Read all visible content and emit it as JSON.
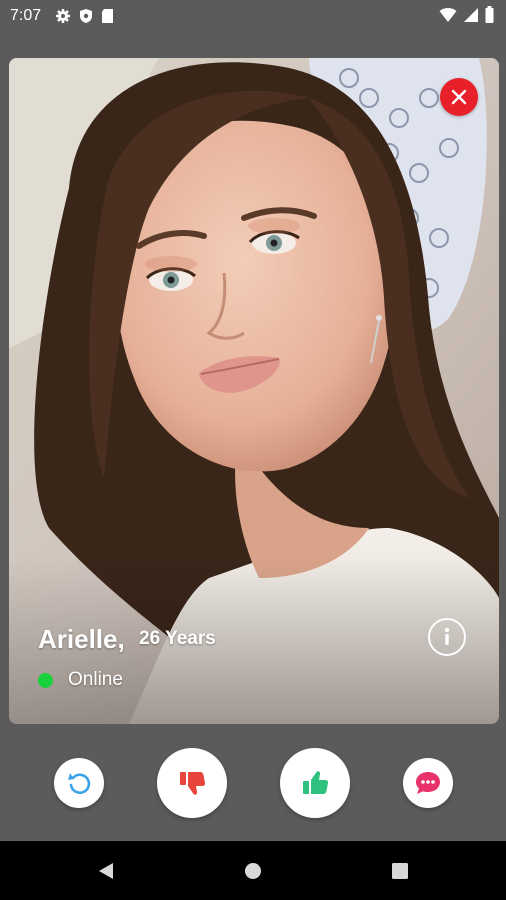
{
  "status_bar": {
    "time": "7:07"
  },
  "profile": {
    "name": "Arielle,",
    "age": "26 Years",
    "status": "Online"
  },
  "colors": {
    "close": "#e8202a",
    "online": "#19d13a",
    "undo": "#3aa3e8",
    "dislike": "#e8453c",
    "like": "#2ec27e",
    "chat": "#e8336a"
  },
  "actions": [
    "undo-icon",
    "thumbs-down-icon",
    "thumbs-up-icon",
    "chat-icon"
  ]
}
